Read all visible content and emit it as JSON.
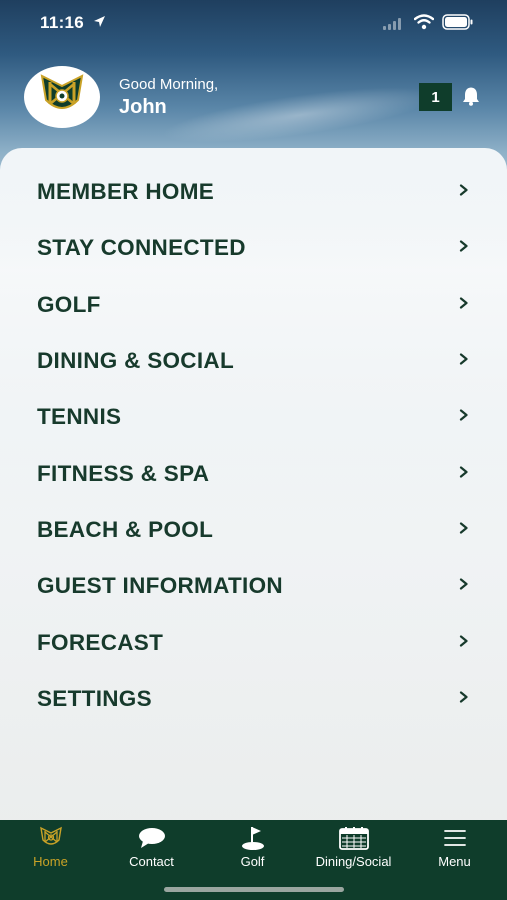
{
  "status_bar": {
    "time": "11:16",
    "icons": [
      "location-arrow-icon",
      "cellular-icon",
      "wifi-icon",
      "battery-icon"
    ]
  },
  "header": {
    "greeting": "Good Morning,",
    "user_name": "John",
    "notification_count": "1",
    "logo_icon": "club-crest-icon",
    "notification_icon": "bell-icon"
  },
  "menu": {
    "items": [
      {
        "label": "MEMBER HOME"
      },
      {
        "label": "STAY CONNECTED"
      },
      {
        "label": "GOLF"
      },
      {
        "label": "DINING & SOCIAL"
      },
      {
        "label": "TENNIS"
      },
      {
        "label": "FITNESS & SPA"
      },
      {
        "label": "BEACH & POOL"
      },
      {
        "label": "GUEST INFORMATION"
      },
      {
        "label": "FORECAST"
      },
      {
        "label": "SETTINGS"
      }
    ],
    "chevron_icon": "chevron-right-icon"
  },
  "tab_bar": {
    "tabs": [
      {
        "label": "Home",
        "icon": "club-crest-icon",
        "active": true
      },
      {
        "label": "Contact",
        "icon": "chat-bubble-icon",
        "active": false
      },
      {
        "label": "Golf",
        "icon": "golf-flag-icon",
        "active": false
      },
      {
        "label": "Dining/Social",
        "icon": "calendar-icon",
        "active": false
      },
      {
        "label": "Menu",
        "icon": "hamburger-menu-icon",
        "active": false
      }
    ]
  },
  "colors": {
    "brand_green": "#0f3d2b",
    "accent_gold": "#c9a227",
    "menu_text": "#173a2c"
  }
}
